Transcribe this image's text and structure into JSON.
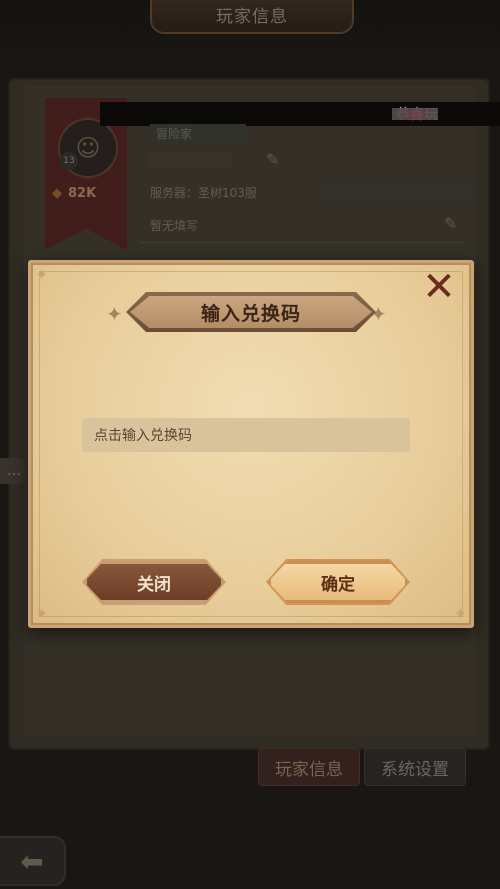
{
  "window": {
    "title": "玩家信息"
  },
  "notice": {
    "text": "恭喜玩"
  },
  "profile": {
    "rank_tag": "冒险家",
    "level": "13",
    "power": "82K",
    "server": "服务器：圣树103服",
    "signature": "暂无填写"
  },
  "dialog": {
    "title": "输入兑换码",
    "input_placeholder": "点击输入兑换码",
    "close_label": "关闭",
    "confirm_label": "确定"
  },
  "tabs": [
    {
      "label": "玩家信息",
      "active": true
    },
    {
      "label": "系统设置",
      "active": false
    }
  ],
  "colors": {
    "dialog_bg": "#f1ddb3",
    "accent_dark": "#6a3c26",
    "accent_light": "#f6d9a8"
  }
}
